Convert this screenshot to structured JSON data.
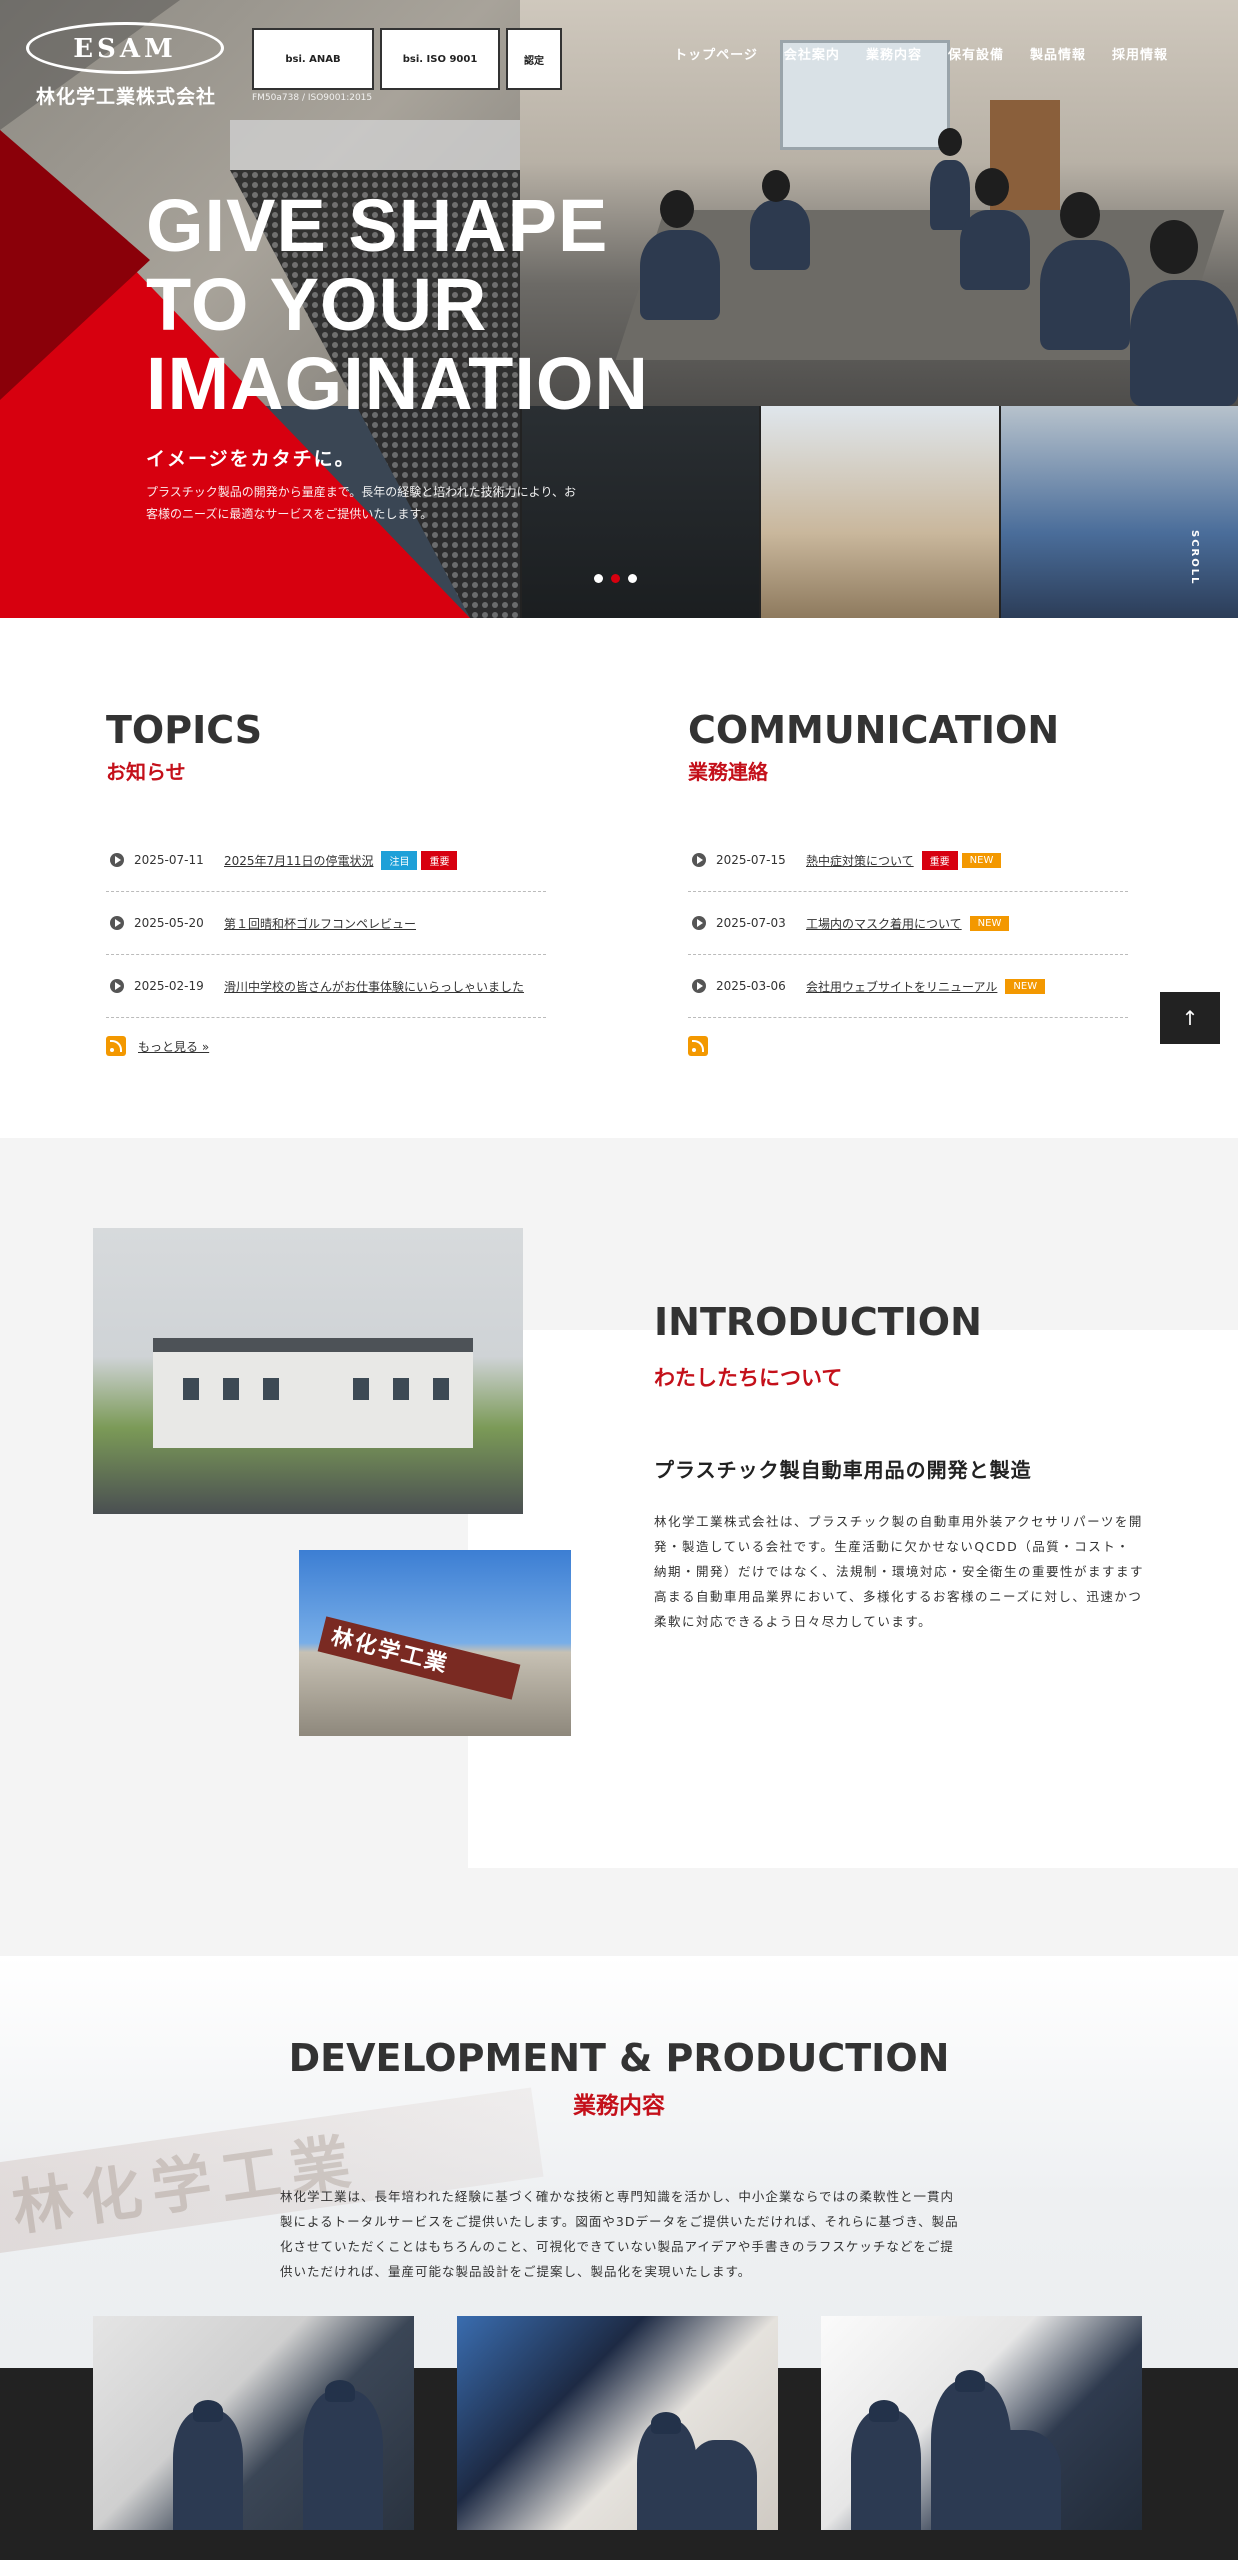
{
  "header": {
    "logo_text": "ESAM",
    "company_name": "林化学工業株式会社",
    "certs": [
      {
        "label": "bsi. ANAB"
      },
      {
        "label": "bsi. ISO 9001"
      },
      {
        "label": "認定"
      }
    ],
    "cert_caption": "FM50a738 / ISO9001:2015",
    "nav": [
      "トップページ",
      "会社案内",
      "業務内容",
      "保有設備",
      "製品情報",
      "採用情報"
    ]
  },
  "hero": {
    "title": "GIVE SHAPE\nTO YOUR\nIMAGINATION",
    "subtitle": "イメージをカタチに。",
    "lead": "プラスチック製品の開発から量産まで。長年の経験と培われた技術力により、お客様のニーズに最適なサービスをご提供いたします。",
    "scroll_label": "SCROLL",
    "slides_total": 3,
    "slide_active": 2
  },
  "topics": {
    "title_en": "TOPICS",
    "title_ja": "お知らせ",
    "items": [
      {
        "date": "2025-07-11",
        "title": "2025年7月11日の停電状況",
        "badges": [
          {
            "text": "注目",
            "color": "#1ea0d8"
          },
          {
            "text": "重要",
            "color": "#d7000f"
          }
        ]
      },
      {
        "date": "2025-05-20",
        "title": "第１回晴和杯ゴルフコンペレビュー",
        "badges": []
      },
      {
        "date": "2025-02-19",
        "title": "滑川中学校の皆さんがお仕事体験にいらっしゃいました",
        "badges": []
      }
    ],
    "more_label": "もっと見る »"
  },
  "communication": {
    "title_en": "COMMUNICATION",
    "title_ja": "業務連絡",
    "items": [
      {
        "date": "2025-07-15",
        "title": "熱中症対策について",
        "badges": [
          {
            "text": "重要",
            "color": "#d7000f"
          },
          {
            "text": "NEW",
            "color": "#f39800"
          }
        ]
      },
      {
        "date": "2025-07-03",
        "title": "工場内のマスク着用について",
        "badges": [
          {
            "text": "NEW",
            "color": "#f39800"
          }
        ]
      },
      {
        "date": "2025-03-06",
        "title": "会社用ウェブサイトをリニューアル",
        "badges": [
          {
            "text": "NEW",
            "color": "#f39800"
          }
        ]
      }
    ]
  },
  "to_top": "↑",
  "introduction": {
    "title_en": "INTRODUCTION",
    "title_ja": "わたしたちについて",
    "heading": "プラスチック製自動車用品の開発と製造",
    "body": "林化学工業株式会社は、プラスチック製の自動車用外装アクセサリパーツを開発・製造している会社です。生産活動に欠かせないQCDD（品質・コスト・納期・開発）だけではなく、法規制・環境対応・安全衛生の重要性がますます高まる自動車用品業界において、多様化するお客様のニーズに対し、迅速かつ柔軟に対応できるよう日々尽力しています。",
    "sign_text": "林化学工業"
  },
  "development": {
    "title_en": "DEVELOPMENT & PRODUCTION",
    "title_ja": "業務内容",
    "body": "林化学工業は、長年培われた経験に基づく確かな技術と専門知識を活かし、中小企業ならではの柔軟性と一貫内製によるトータルサービスをご提供いたします。図面や3Dデータをご提供いただければ、それらに基づき、製品化させていただくことはもちろんのこと、可視化できていない製品アイデアや手書きのラフスケッチなどをご提供いただければ、量産可能な製品設計をご提案し、製品化を実現いたします。",
    "bg_sign": "林化学工業"
  },
  "colors": {
    "accent_red": "#d7000f",
    "heading_red": "#c4101a",
    "badge_blue": "#1ea0d8",
    "badge_orange": "#f39800"
  }
}
